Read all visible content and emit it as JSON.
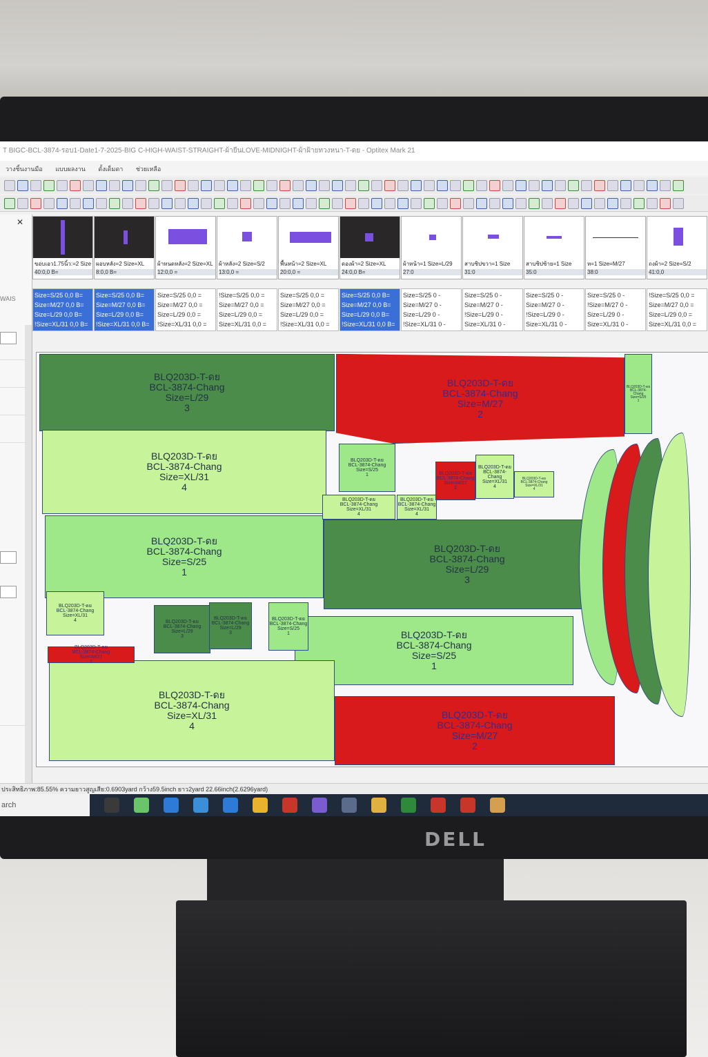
{
  "window": {
    "title": "T BIGC-BCL-3874-รอบ1-Date1-7-2025-BIG C-HIGH-WAIST-STRAIGHT-ผ้ายีนLOVE-MIDNIGHT-ผ้าฝ้ายทวงหนา-T-ดย - Optitex Mark 21"
  },
  "menu": [
    "วางชิ้นงานมือ",
    "แบบผลงาน",
    "ดั้งเด็มดา",
    "ช่วยเหลือ"
  ],
  "left_panel": {
    "close_glyph": "✕",
    "label": "WAIS"
  },
  "pieces": [
    {
      "name": "ขอบเอว1.75นิ้ว:=2 Size",
      "code": "40:0,0",
      "suffix": "B="
    },
    {
      "name": "ผอบหลัง=2 Size=XL",
      "code": "8:0,0",
      "suffix": "B="
    },
    {
      "name": "ผ้าหนดหลัง=2 Size=XL",
      "code": "12:0,0",
      "suffix": "="
    },
    {
      "name": "ผ้าหลัง=2 Size=S/2",
      "code": "13:0,0",
      "suffix": "="
    },
    {
      "name": "พื้นหน้า=2 Size=XL",
      "code": "20:0,0",
      "suffix": "="
    },
    {
      "name": "ดองผ้า=2 Size=XL",
      "code": "24:0,0",
      "suffix": "B="
    },
    {
      "name": "ผ้าหน้า=1 Size=L/29",
      "code": "27:0",
      "suffix": ""
    },
    {
      "name": "สาบซิปขวา=1 Size",
      "code": "31:0",
      "suffix": ""
    },
    {
      "name": "สาบซิปซ้าย=1 Size",
      "code": "35:0",
      "suffix": ""
    },
    {
      "name": "ห=1 Size=M/27",
      "code": "38:0",
      "suffix": ""
    },
    {
      "name": "ถงผ้า=2 Size=S/2",
      "code": "41:0,0",
      "suffix": ""
    }
  ],
  "sizes": [
    {
      "lines": [
        "Size=S/25 0,0 B=",
        "Size=M/27 0,0 B=",
        "Size=L/29 0,0 B=",
        "!Size=XL/31 0,0 B="
      ],
      "selected": true
    },
    {
      "lines": [
        "Size=S/25 0,0 B=",
        "Size=M/27 0,0 B=",
        "Size=L/29 0,0 B=",
        "!Size=XL/31 0,0 B="
      ],
      "selected": true
    },
    {
      "lines": [
        "Size=S/25 0,0 =",
        "Size=M/27 0,0 =",
        "Size=L/29 0,0 =",
        "!Size=XL/31 0,0 ="
      ],
      "selected": false
    },
    {
      "lines": [
        "!Size=S/25 0,0 =",
        "Size=M/27 0,0 =",
        "Size=L/29 0,0 =",
        "Size=XL/31 0,0 ="
      ],
      "selected": false
    },
    {
      "lines": [
        "Size=S/25 0,0 =",
        "Size=M/27 0,0 =",
        "Size=L/29 0,0 =",
        "!Size=XL/31 0,0 ="
      ],
      "selected": false
    },
    {
      "lines": [
        "Size=S/25 0,0 B=",
        "Size=M/27 0,0 B=",
        "Size=L/29 0,0 B=",
        "!Size=XL/31 0,0 B="
      ],
      "selected": true
    },
    {
      "lines": [
        "Size=S/25 0 -",
        "Size=M/27 0 -",
        "Size=L/29 0 -",
        "!Size=XL/31 0 -"
      ],
      "selected": false
    },
    {
      "lines": [
        "Size=S/25 0 -",
        "Size=M/27 0 -",
        "!Size=L/29 0 -",
        "Size=XL/31 0 -"
      ],
      "selected": false
    },
    {
      "lines": [
        "Size=S/25 0 -",
        "Size=M/27 0 -",
        "!Size=L/29 0 -",
        "Size=XL/31 0 -"
      ],
      "selected": false
    },
    {
      "lines": [
        "Size=S/25 0 -",
        "!Size=M/27 0 -",
        "Size=L/29 0 -",
        "Size=XL/31 0 -"
      ],
      "selected": false
    },
    {
      "lines": [
        "!Size=S/25 0,0 =",
        "Size=M/27 0,0 =",
        "Size=L/29 0,0 =",
        "Size=XL/31 0,0 ="
      ],
      "selected": false
    }
  ],
  "marker_pieces": [
    {
      "label": "BLQ203D-T-ดย\nBCL-3874-Chang\nSize=L/29\n3",
      "color": "dg"
    },
    {
      "label": "BLQ203D-T-ดย\nBCL-3874-Chang\nSize=M/27\n2",
      "color": "rd"
    },
    {
      "label": "BLQ203D-T-ดย\nBCL-3874-Chang\nSize=XL/31\n4",
      "color": "lg"
    },
    {
      "label": "BLQ203D-T-ดย\nBCL-3874-Chang\nSize=S/25\n1",
      "color": "mg"
    },
    {
      "label": "BLQ203D-T-ดย\nBCL-3874-Chang\nSize=L/29\n3",
      "color": "dg"
    },
    {
      "label": "BLQ203D-T-ดย\nBCL-3874-Chang\nSize=S/25\n1",
      "color": "mg"
    },
    {
      "label": "BLQ203D-T-ดย\nBCL-3874-Chang\nSize=XL/31\n4",
      "color": "lg"
    },
    {
      "label": "BLQ203D-T-ดย\nBCL-3874-Chang\nSize=M/27\n2",
      "color": "rd"
    },
    {
      "label": "BLQ203D-T-ดย\nBCL-3874-Chang\nSize=S/25\n1",
      "color": "mg"
    },
    {
      "label": "BLQ203D-T-ดย\nBCL-3874-Chang\nSize=XL/31\n4",
      "color": "lg"
    },
    {
      "label": "BLQ203D-T-ดย\nBCL-3874-Chang\nSize=XL/31\n4",
      "color": "lg"
    },
    {
      "label": "BLQ203D-T-ดย\nBCL-3874-Chang\nSize=XL/31\n4",
      "color": "lg"
    },
    {
      "label": "BLQ203D-T-ดย\nBCL-3874-Chang\nSize=M/27\n2",
      "color": "rd"
    },
    {
      "label": "BLQ203D-T-ดย\nBCL-3874-Chang\nSize=L/29\n3",
      "color": "dg"
    },
    {
      "label": "BLQ203D-T-ดย\nBCL-3874-Chang\nSize=M/27\n2",
      "color": "rd"
    },
    {
      "label": "BLQ203D-T-ดย\nBCL-3874-Chang\nSize=XL/31\n4",
      "color": "lg"
    },
    {
      "label": "BLQ203D-T-ดย\nBCL-3874-Chang\nSize=XL/31\n4",
      "color": "lg"
    },
    {
      "label": "BLQ203D-T-ดย\nBCL-3874-Chang\nSize=S/25\n1",
      "color": "mg"
    },
    {
      "label": "BLQ203D-T-ดย\nBCL-3874-Chang\nSize=L/29\n3",
      "color": "dg"
    },
    {
      "label": "BLQ203D-T-ดย\nBCL-3874-Chang\nSize=S/25\n1",
      "color": "mg"
    }
  ],
  "status": {
    "text": "ประสิทธิภาพ:85.55%  ความยาวสูญเสีย:0.6903yard  กว้าง59.5inch  ยาว2yard 22.66inch(2.6296yard)"
  },
  "taskbar": {
    "search_text": "arch"
  },
  "monitor": {
    "brand": "DELL"
  },
  "colors": {
    "dark_green": "#4c8c4a",
    "light_green": "#c7f49a",
    "mid_green": "#9ee88a",
    "red": "#d81a1a",
    "selection_blue": "#3a6fd8"
  }
}
